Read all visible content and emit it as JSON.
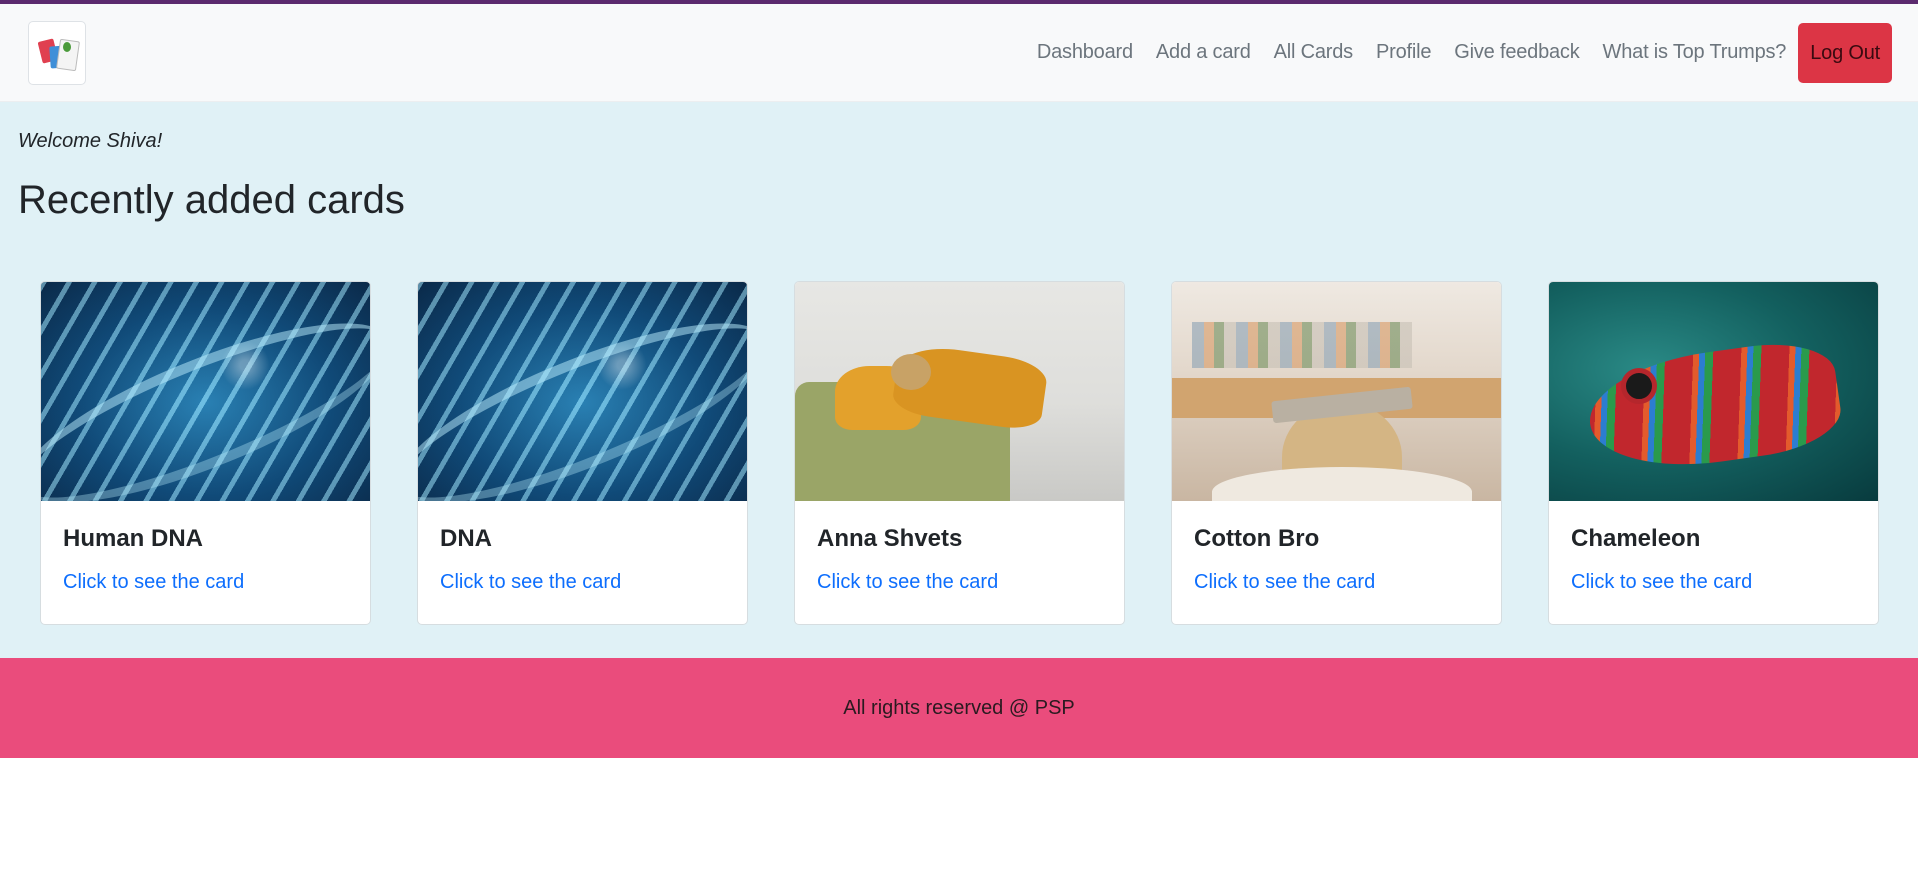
{
  "nav": {
    "items": [
      {
        "label": "Dashboard"
      },
      {
        "label": "Add a card"
      },
      {
        "label": "All Cards"
      },
      {
        "label": "Profile"
      },
      {
        "label": "Give feedback"
      },
      {
        "label": "What is Top Trumps?"
      }
    ],
    "logout_label": "Log Out",
    "logo_icon": "top-trumps-cards-logo"
  },
  "main": {
    "welcome": "Welcome Shiva!",
    "heading": "Recently added cards",
    "cards": [
      {
        "title": "Human DNA",
        "link": "Click to see the card",
        "image": "dna-helix"
      },
      {
        "title": "DNA",
        "link": "Click to see the card",
        "image": "dna-helix"
      },
      {
        "title": "Anna Shvets",
        "link": "Click to see the card",
        "image": "children-on-sofa"
      },
      {
        "title": "Cotton Bro",
        "link": "Click to see the card",
        "image": "person-with-book"
      },
      {
        "title": "Chameleon",
        "link": "Click to see the card",
        "image": "chameleon"
      }
    ]
  },
  "footer": {
    "text": "All rights reserved @ PSP"
  },
  "colors": {
    "navbar_bg": "#f8f9fa",
    "main_bg": "#e0f1f6",
    "logout_bg": "#dc3545",
    "link": "#0d6efd",
    "footer_bg": "#ea4c7c",
    "top_border": "#5b2a6e"
  }
}
